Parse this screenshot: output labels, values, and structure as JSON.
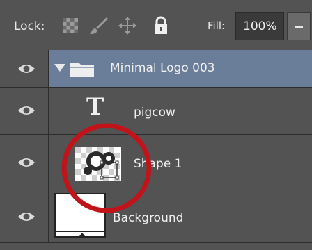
{
  "toolbar": {
    "lock_label": "Lock:",
    "lock_icons": [
      "lock-transparent-pixels-icon",
      "lock-image-pixels-icon",
      "lock-position-icon",
      "lock-all-icon"
    ],
    "fill_label": "Fill:",
    "fill_value": "100%"
  },
  "layers": [
    {
      "name": "Minimal Logo 003",
      "type": "group",
      "selected": true,
      "visible": true
    },
    {
      "name": "pigcow",
      "type": "text",
      "visible": true
    },
    {
      "name": "Shape 1",
      "type": "shape",
      "visible": true
    },
    {
      "name": "Background",
      "type": "background",
      "visible": true
    }
  ],
  "colors": {
    "panel_bg": "#535353",
    "selected_row": "#6a7d99",
    "highlight": "#c0141a"
  }
}
